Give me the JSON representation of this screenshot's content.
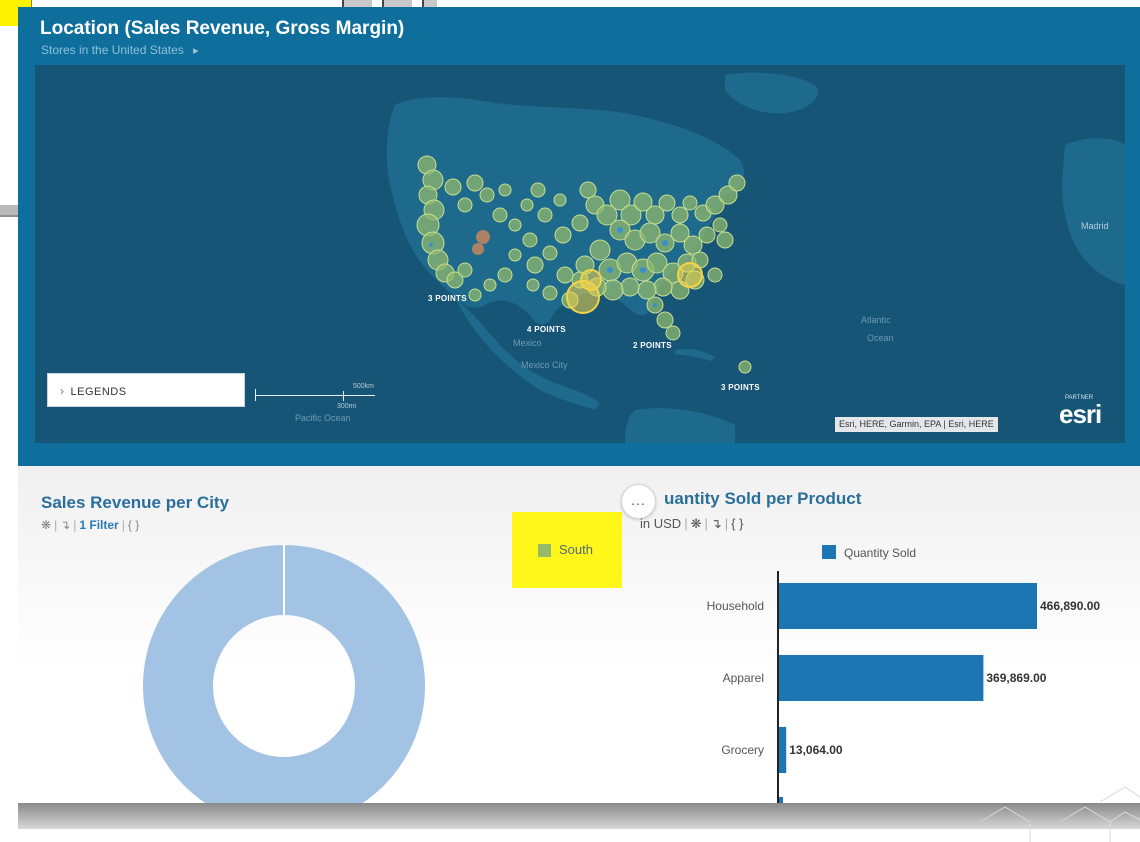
{
  "map": {
    "title": "Location (Sales Revenue, Gross Margin)",
    "subtitle": "Stores in the United States",
    "legends_label": "LEGENDS",
    "scale_km": "500km",
    "scale_mi": "300mi",
    "attribution": "Esri, HERE, Garmin, EPA | Esri, HERE",
    "logo": "esri",
    "logo_top": "PARTNER",
    "point_labels": [
      "3 POINTS",
      "4 POINTS",
      "2 POINTS",
      "3 POINTS"
    ],
    "place_labels": [
      "Mexico",
      "Mexico City",
      "Atlantic",
      "Ocean",
      "Madrid",
      "Pacific Ocean"
    ],
    "bubble_color": "#8fb86e",
    "highlight_color": "#f3d34a",
    "accent_color": "#0e6f9d"
  },
  "donut_card": {
    "title": "Sales Revenue per City",
    "filter_label": "1 Filter",
    "meta_braces": "{ }",
    "legend_label": "South",
    "legend_color": "#98b96a",
    "slice_color": "#a3c3e4"
  },
  "more_menu": {
    "label": "..."
  },
  "bar_card": {
    "title": "uantity Sold per Product",
    "unit": "in USD",
    "meta_braces": "{ }"
  },
  "chart_data": {
    "type": "bar",
    "orientation": "horizontal",
    "title": "Quantity Sold per Product",
    "categories": [
      "Household",
      "Apparel",
      "Grocery"
    ],
    "series": [
      {
        "name": "Quantity Sold",
        "values": [
          466890.0,
          369869.0,
          13064.0
        ]
      }
    ],
    "data_labels": [
      "466,890.00",
      "369,869.00",
      "13,064.00"
    ],
    "legend_position": "top",
    "bar_color": "#1d76b1"
  }
}
